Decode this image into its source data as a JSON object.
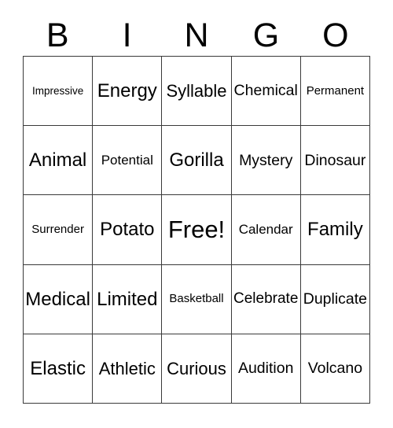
{
  "card": {
    "title": "BINGO",
    "header_letters": [
      "B",
      "I",
      "N",
      "G",
      "O"
    ],
    "free_space_label": "Free!",
    "colors": {
      "background": "#ffffff",
      "text": "#000000",
      "grid_line": "#3a3a3a"
    },
    "grid": {
      "columns": 5,
      "rows": 5,
      "rows_data": [
        [
          {
            "text": "Impressive",
            "size": "fs-xs"
          },
          {
            "text": "Energy",
            "size": "fs-xxl"
          },
          {
            "text": "Syllable",
            "size": "fs-xl"
          },
          {
            "text": "Chemical",
            "size": "fs-l"
          },
          {
            "text": "Permanent",
            "size": "fs-s"
          }
        ],
        [
          {
            "text": "Animal",
            "size": "fs-xxl"
          },
          {
            "text": "Potential",
            "size": "fs-m"
          },
          {
            "text": "Gorilla",
            "size": "fs-xxl"
          },
          {
            "text": "Mystery",
            "size": "fs-l"
          },
          {
            "text": "Dinosaur",
            "size": "fs-l"
          }
        ],
        [
          {
            "text": "Surrender",
            "size": "fs-s"
          },
          {
            "text": "Potato",
            "size": "fs-xxl"
          },
          {
            "text": "Free!",
            "size": "fs-free"
          },
          {
            "text": "Calendar",
            "size": "fs-m"
          },
          {
            "text": "Family",
            "size": "fs-xxl"
          }
        ],
        [
          {
            "text": "Medical",
            "size": "fs-xxl"
          },
          {
            "text": "Limited",
            "size": "fs-xxl"
          },
          {
            "text": "Basketball",
            "size": "fs-s"
          },
          {
            "text": "Celebrate",
            "size": "fs-l"
          },
          {
            "text": "Duplicate",
            "size": "fs-l"
          }
        ],
        [
          {
            "text": "Elastic",
            "size": "fs-xxl"
          },
          {
            "text": "Athletic",
            "size": "fs-xl"
          },
          {
            "text": "Curious",
            "size": "fs-xl"
          },
          {
            "text": "Audition",
            "size": "fs-l"
          },
          {
            "text": "Volcano",
            "size": "fs-l"
          }
        ]
      ]
    }
  }
}
